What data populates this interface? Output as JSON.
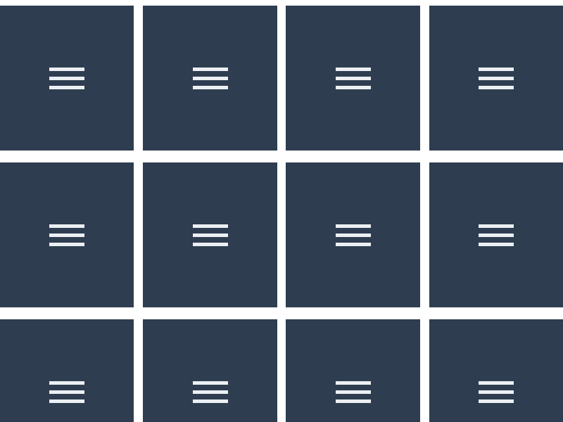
{
  "colors": {
    "tile_background": "#2e3d50",
    "icon": "#ecf0f3",
    "page_background": "#ffffff"
  },
  "tiles": [
    {
      "icon": "hamburger-menu-icon"
    },
    {
      "icon": "hamburger-menu-icon"
    },
    {
      "icon": "hamburger-menu-icon"
    },
    {
      "icon": "hamburger-menu-icon"
    },
    {
      "icon": "hamburger-menu-icon"
    },
    {
      "icon": "hamburger-menu-icon"
    },
    {
      "icon": "hamburger-menu-icon"
    },
    {
      "icon": "hamburger-menu-icon"
    },
    {
      "icon": "hamburger-menu-icon"
    },
    {
      "icon": "hamburger-menu-icon"
    },
    {
      "icon": "hamburger-menu-icon"
    },
    {
      "icon": "hamburger-menu-icon"
    }
  ]
}
